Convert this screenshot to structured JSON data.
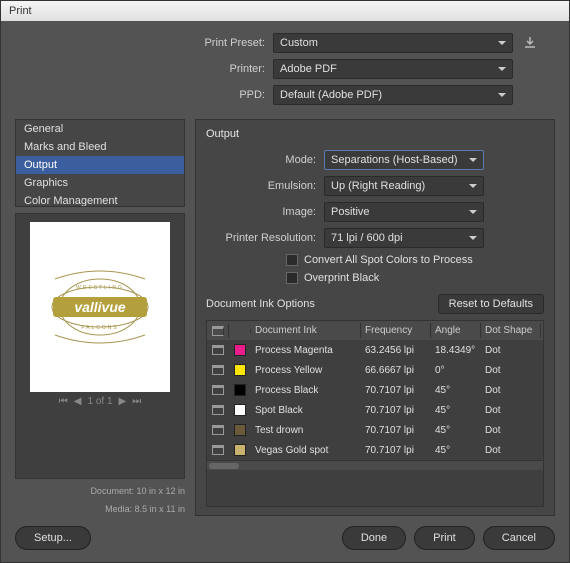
{
  "titlebar": "Print",
  "top": {
    "preset_label": "Print Preset:",
    "preset_value": "Custom",
    "printer_label": "Printer:",
    "printer_value": "Adobe PDF",
    "ppd_label": "PPD:",
    "ppd_value": "Default (Adobe PDF)"
  },
  "sidebar": {
    "items": [
      "General",
      "Marks and Bleed",
      "Output",
      "Graphics",
      "Color Management"
    ],
    "selected": 2
  },
  "preview": {
    "pager": "1 of 1",
    "doc_line": "Document: 10 in x 12 in",
    "media_line": "Media: 8.5 in x 11 in"
  },
  "panel": {
    "title": "Output",
    "mode_label": "Mode:",
    "mode_value": "Separations (Host-Based)",
    "emulsion_label": "Emulsion:",
    "emulsion_value": "Up (Right Reading)",
    "image_label": "Image:",
    "image_value": "Positive",
    "res_label": "Printer Resolution:",
    "res_value": "71 lpi / 600 dpi",
    "convert_spot": "Convert All Spot Colors to Process",
    "overprint": "Overprint Black",
    "ink_title": "Document Ink Options",
    "reset": "Reset to Defaults",
    "headers": {
      "ink": "Document Ink",
      "freq": "Frequency",
      "angle": "Angle",
      "shape": "Dot Shape"
    },
    "inks": [
      {
        "name": "Process Magenta",
        "color": "#e91e8c",
        "freq": "63.2456 lpi",
        "angle": "18.4349°",
        "shape": "Dot",
        "print": true
      },
      {
        "name": "Process Yellow",
        "color": "#ffe600",
        "freq": "66.6667 lpi",
        "angle": "0°",
        "shape": "Dot",
        "print": true
      },
      {
        "name": "Process Black",
        "color": "#000000",
        "freq": "70.7107 lpi",
        "angle": "45°",
        "shape": "Dot",
        "print": true
      },
      {
        "name": "Spot Black",
        "color": "#ffffff",
        "freq": "70.7107 lpi",
        "angle": "45°",
        "shape": "Dot",
        "print": true
      },
      {
        "name": "Test drown",
        "color": "#6b5a3a",
        "freq": "70.7107 lpi",
        "angle": "45°",
        "shape": "Dot",
        "print": true
      },
      {
        "name": "Vegas Gold spot",
        "color": "#c9b26b",
        "freq": "70.7107 lpi",
        "angle": "45°",
        "shape": "Dot",
        "print": true
      }
    ]
  },
  "buttons": {
    "setup": "Setup...",
    "done": "Done",
    "print": "Print",
    "cancel": "Cancel"
  },
  "logo": {
    "brand": "vallivue",
    "top": "WRESTLING",
    "bottom": "FALCONS"
  }
}
